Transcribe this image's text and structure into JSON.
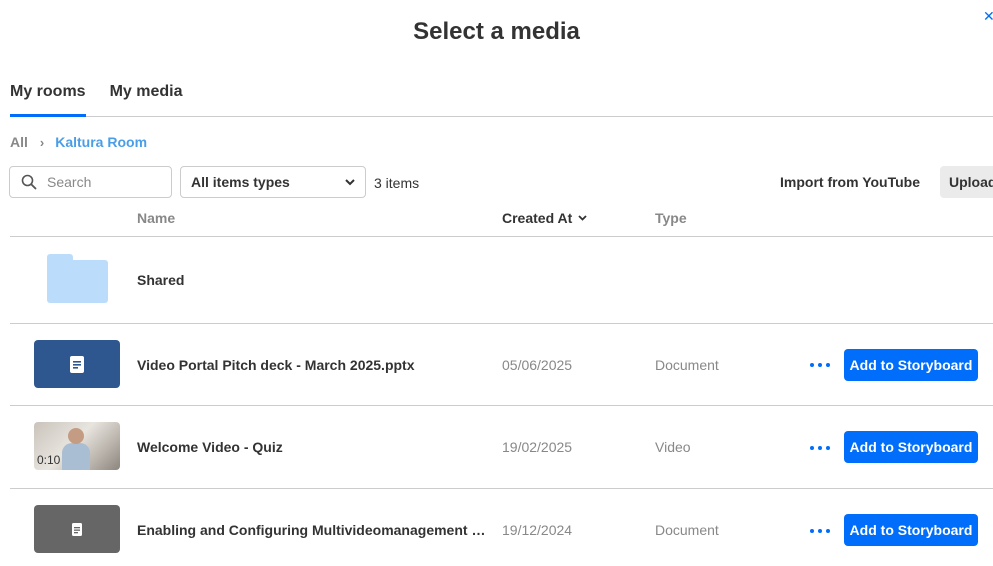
{
  "dialog": {
    "title": "Select a media",
    "close_icon": "close-icon"
  },
  "tabs": [
    {
      "label": "My rooms",
      "active": true
    },
    {
      "label": "My media",
      "active": false
    }
  ],
  "breadcrumb": {
    "root": "All",
    "separator_icon": "chevron-right-icon",
    "current": "Kaltura Room"
  },
  "toolbar": {
    "search_placeholder": "Search",
    "search_value": "",
    "filter_selected": "All items types",
    "item_count": "3 items",
    "import_label": "Import from YouTube",
    "upload_label": "Upload"
  },
  "columns": {
    "name": "Name",
    "created_at": "Created At",
    "type": "Type"
  },
  "rows": [
    {
      "kind": "folder",
      "icon": "folder-icon",
      "name": "Shared",
      "created": "",
      "type": ""
    },
    {
      "kind": "document",
      "icon": "document-icon",
      "name": "Video Portal Pitch deck - March 2025.pptx",
      "created": "05/06/2025",
      "type": "Document",
      "action_label": "Add to Storyboard"
    },
    {
      "kind": "video",
      "icon": "video-thumbnail",
      "duration": "0:10",
      "name": "Welcome Video - Quiz",
      "created": "19/02/2025",
      "type": "Video",
      "action_label": "Add to Storyboard"
    },
    {
      "kind": "document",
      "icon": "document-icon",
      "name": "Enabling and Configuring Multivideomanagement M...",
      "created": "19/12/2024",
      "type": "Document",
      "action_label": "Add to Storyboard"
    }
  ],
  "colors": {
    "accent": "#006efa",
    "breadcrumb_link": "#4a9ee8",
    "doc_thumb_blue": "#2e5790",
    "doc_thumb_gray": "#666666",
    "folder": "#bcdcfc"
  }
}
